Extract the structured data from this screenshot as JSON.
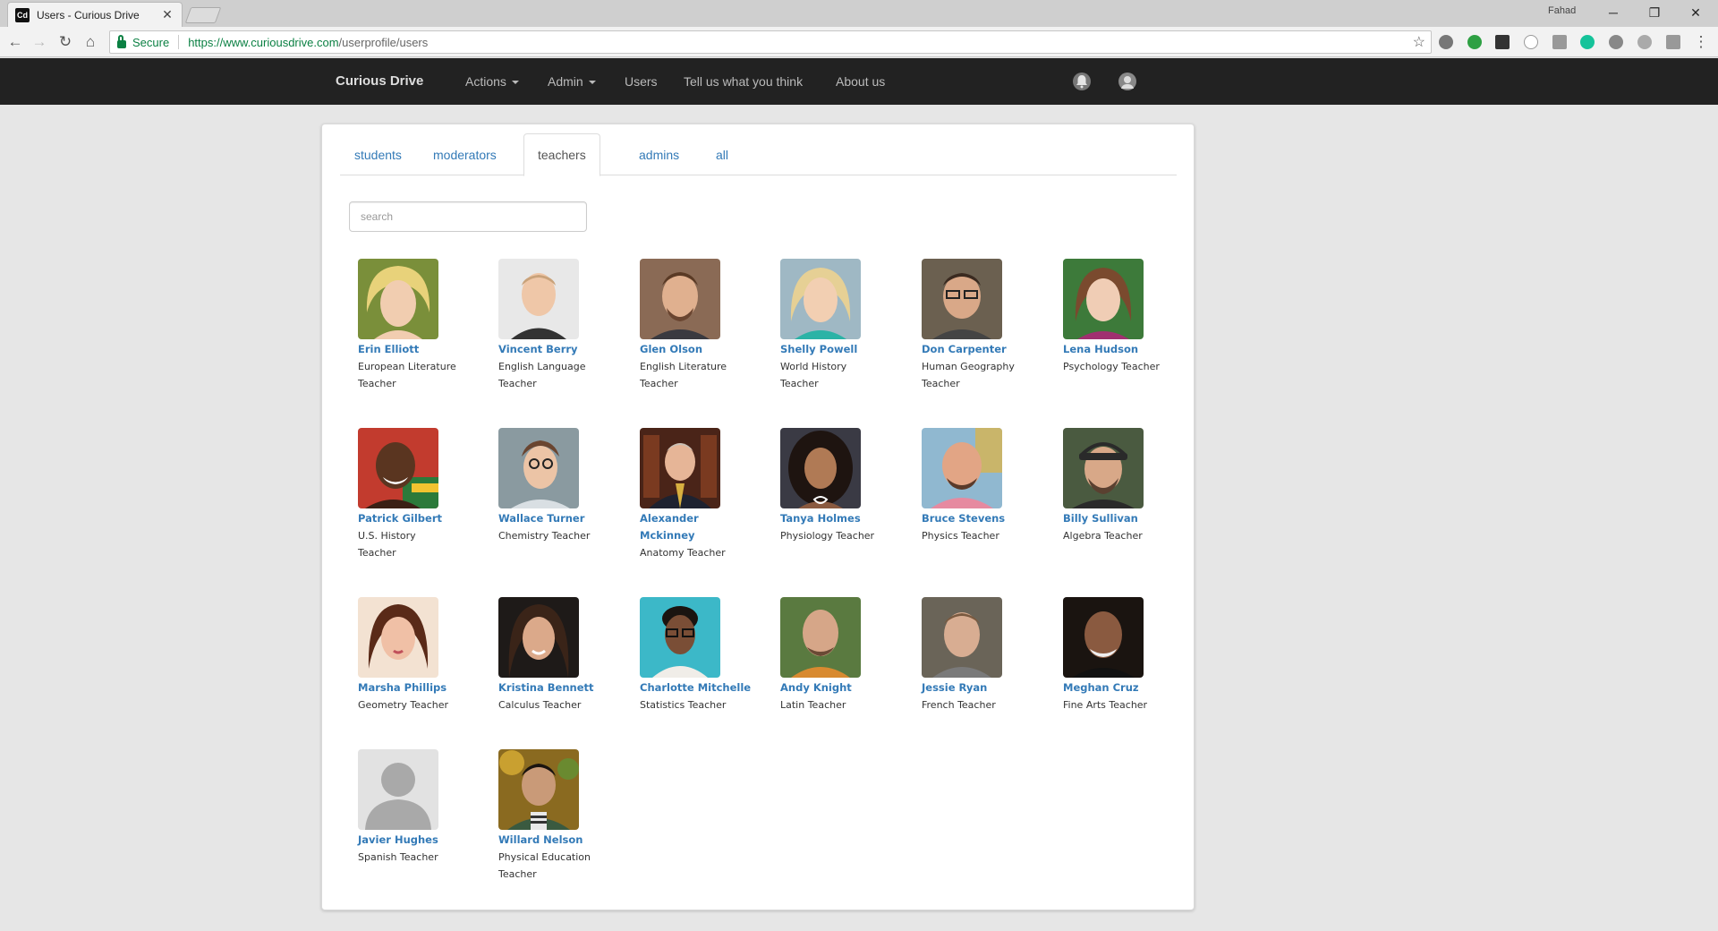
{
  "browser": {
    "tab_title": "Users - Curious Drive",
    "tab_favicon": "Cd",
    "profile_name": "Fahad",
    "secure_label": "Secure",
    "url_domain": "https://www.curiousdrive.com",
    "url_path": "/userprofile/users"
  },
  "navbar": {
    "brand": "Curious Drive",
    "items": [
      "Actions",
      "Admin",
      "Users",
      "Tell us what you think",
      "About us"
    ]
  },
  "tabs": [
    "students",
    "moderators",
    "teachers",
    "admins",
    "all"
  ],
  "active_tab": "teachers",
  "search": {
    "placeholder": "search",
    "value": ""
  },
  "users": [
    {
      "name": "Erin Elliott",
      "role": "European Literature Teacher"
    },
    {
      "name": "Vincent Berry",
      "role": "English Language Teacher"
    },
    {
      "name": "Glen Olson",
      "role": "English Literature Teacher"
    },
    {
      "name": "Shelly Powell",
      "role": "World History Teacher"
    },
    {
      "name": "Don Carpenter",
      "role": "Human Geography Teacher"
    },
    {
      "name": "Lena Hudson",
      "role": "Psychology Teacher"
    },
    {
      "name": "Patrick Gilbert",
      "role": "U.S. History Teacher"
    },
    {
      "name": "Wallace Turner",
      "role": "Chemistry Teacher"
    },
    {
      "name": "Alexander Mckinney",
      "role": "Anatomy Teacher"
    },
    {
      "name": "Tanya Holmes",
      "role": "Physiology Teacher"
    },
    {
      "name": "Bruce Stevens",
      "role": "Physics Teacher"
    },
    {
      "name": "Billy Sullivan",
      "role": "Algebra Teacher"
    },
    {
      "name": "Marsha Phillips",
      "role": "Geometry Teacher"
    },
    {
      "name": "Kristina Bennett",
      "role": "Calculus Teacher"
    },
    {
      "name": "Charlotte Mitchelle",
      "role": "Statistics Teacher"
    },
    {
      "name": "Andy Knight",
      "role": "Latin Teacher"
    },
    {
      "name": "Jessie Ryan",
      "role": "French Teacher"
    },
    {
      "name": "Meghan Cruz",
      "role": "Fine Arts Teacher"
    },
    {
      "name": "Javier Hughes",
      "role": "Spanish Teacher"
    },
    {
      "name": "Willard Nelson",
      "role": "Physical Education Teacher"
    }
  ],
  "colors": {
    "link": "#337ab7",
    "navbar_bg": "#222222",
    "page_bg": "#e6e6e6",
    "secure_green": "#0b8043"
  }
}
